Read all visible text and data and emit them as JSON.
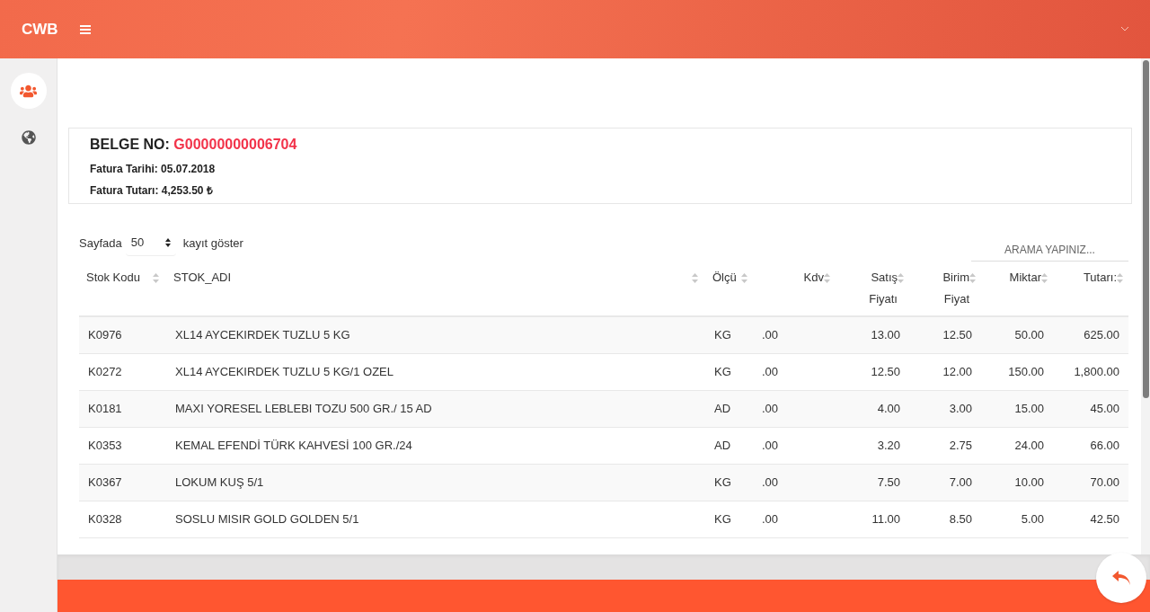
{
  "header": {
    "logo": "CWB"
  },
  "sidebar": {
    "items": [
      {
        "selected": true
      },
      {
        "selected": false
      }
    ]
  },
  "document": {
    "label": "BELGE NO:",
    "number": "G00000000006704",
    "lines": [
      "Fatura Tarihi: 05.07.2018",
      "Fatura Tutarı: 4,253.50 ₺"
    ]
  },
  "table_controls": {
    "before": "Sayfada",
    "page_size": "50",
    "after": "kayıt göster",
    "search": {
      "placeholder": "ARAMA YAPINIZ..."
    }
  },
  "table": {
    "columns": [
      {
        "label": "Stok Kodu"
      },
      {
        "label": "STOK_ADI"
      },
      {
        "label": "Ölçü"
      },
      {
        "label": "Kdv"
      },
      {
        "label": "Satış Fiyatı"
      },
      {
        "label": "Birim Fiyat"
      },
      {
        "label": "Miktar"
      },
      {
        "label": "Tutarı:"
      }
    ],
    "rows": [
      [
        "K0976",
        "XL14 AYCEKIRDEK TUZLU 5 KG",
        "KG",
        ".00",
        "13.00",
        "12.50",
        "50.00",
        "625.00"
      ],
      [
        "K0272",
        "XL14 AYCEKIRDEK TUZLU 5 KG/1 OZEL",
        "KG",
        ".00",
        "12.50",
        "12.00",
        "150.00",
        "1,800.00"
      ],
      [
        "K0181",
        "MAXI YORESEL LEBLEBI TOZU 500 GR./ 15 AD",
        "AD",
        ".00",
        "4.00",
        "3.00",
        "15.00",
        "45.00"
      ],
      [
        "K0353",
        "KEMAL EFENDİ TÜRK KAHVESİ 100 GR./24",
        "AD",
        ".00",
        "3.20",
        "2.75",
        "24.00",
        "66.00"
      ],
      [
        "K0367",
        "LOKUM KUŞ 5/1",
        "KG",
        ".00",
        "7.50",
        "7.00",
        "10.00",
        "70.00"
      ],
      [
        "K0328",
        "SOSLU MISIR GOLD GOLDEN 5/1",
        "KG",
        ".00",
        "11.00",
        "8.50",
        "5.00",
        "42.50"
      ]
    ]
  }
}
